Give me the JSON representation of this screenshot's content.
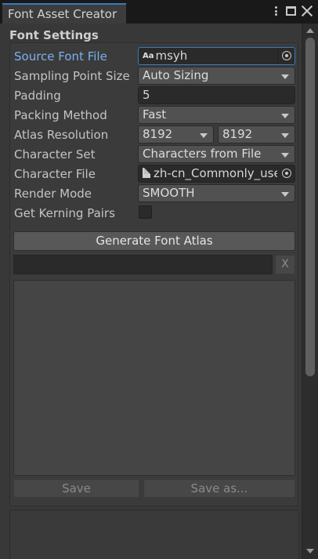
{
  "window": {
    "tab_title": "Font Asset Creator",
    "menu_icon": "kebab-menu-icon",
    "maximize_icon": "maximize-icon",
    "close_icon": "close-icon"
  },
  "section": {
    "title": "Font Settings"
  },
  "fields": {
    "source_font_file": {
      "label": "Source Font File",
      "value": "msyh",
      "icon": "font-asset-icon",
      "picker_icon": "object-picker-icon"
    },
    "sampling_point_size": {
      "label": "Sampling Point Size",
      "value": "Auto Sizing"
    },
    "padding": {
      "label": "Padding",
      "value": "5"
    },
    "packing_method": {
      "label": "Packing Method",
      "value": "Fast"
    },
    "atlas_resolution": {
      "label": "Atlas Resolution",
      "width": "8192",
      "height": "8192"
    },
    "character_set": {
      "label": "Character Set",
      "value": "Characters from File"
    },
    "character_file": {
      "label": "Character File",
      "value": "zh-cn_Commonly_used",
      "icon": "text-file-icon",
      "picker_icon": "object-picker-icon"
    },
    "render_mode": {
      "label": "Render Mode",
      "value": "SMOOTH"
    },
    "get_kerning_pairs": {
      "label": "Get Kerning Pairs",
      "checked": false
    }
  },
  "actions": {
    "generate_label": "Generate Font Atlas",
    "progress": 0,
    "cancel_label": "X",
    "save_label": "Save",
    "save_as_label": "Save as..."
  },
  "colors": {
    "accent": "#3a79bb",
    "active_label": "#7ab0ee",
    "background": "#383838"
  }
}
